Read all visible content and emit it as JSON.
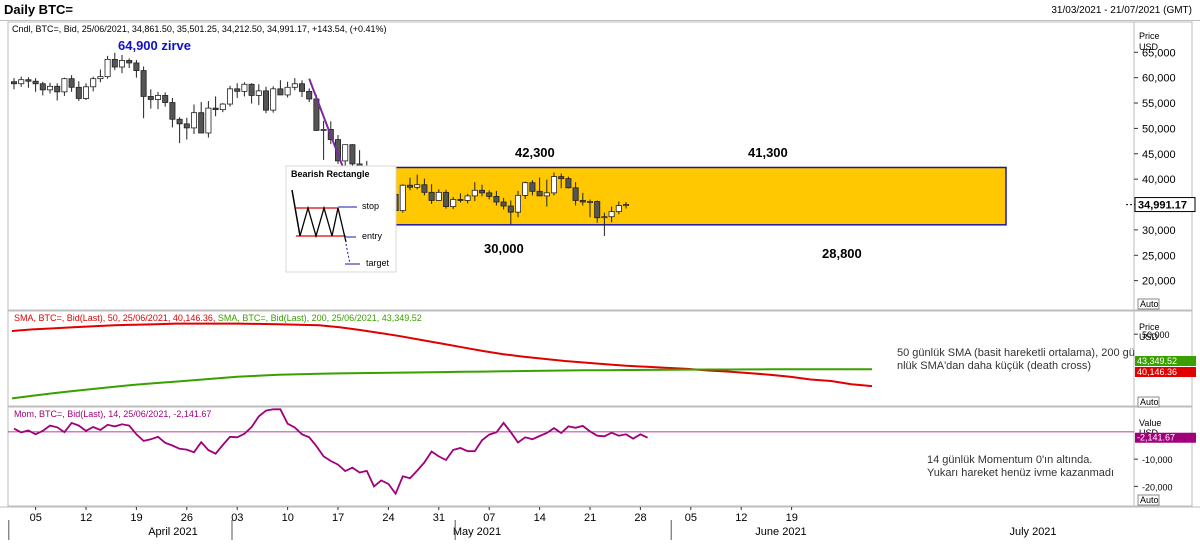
{
  "header": {
    "title": "Daily BTC=",
    "date_range": "31/03/2021 - 21/07/2021 (GMT)"
  },
  "colors": {
    "up": "#ffffff",
    "down": "#555555",
    "rect_fill": "#ffc800",
    "rect_stroke": "#1a1aa0",
    "sma50": "#e00000",
    "sma200": "#3aa000",
    "momentum": "#a0007a",
    "trend_line": "#7a2aa0",
    "annotation_blue": "#1010cc"
  },
  "chart_data": [
    {
      "type": "candlestick",
      "legend": "Cndl, BTC=, Bid, 25/06/2021, 34,861.50, 35,501.25, 34,212.50, 34,991.17, +143.54, (+0.41%)",
      "axis": {
        "title": "Price",
        "unit": "USD",
        "ylim": [
          15000,
          69000
        ],
        "ticks": [
          "65,000",
          "60,000",
          "55,000",
          "50,000",
          "45,000",
          "40,000",
          "35,000",
          "30,000",
          "25,000",
          "20,000"
        ],
        "tick_values": [
          65000,
          60000,
          55000,
          50000,
          45000,
          40000,
          35000,
          30000,
          25000,
          20000
        ]
      },
      "last_price_label": "34,991.17",
      "auto_label": "Auto",
      "annotations": [
        {
          "text": "64,900 zirve",
          "color": "blue"
        },
        {
          "text": "42,300"
        },
        {
          "text": "41,300"
        },
        {
          "text": "30,000"
        },
        {
          "text": "28,800"
        }
      ],
      "rectangle": {
        "top": 42300,
        "bottom": 31000,
        "start_index": 49,
        "end_index": 84
      },
      "trend_line": {
        "from": [
          41,
          59800
        ],
        "to": [
          49,
          30000
        ]
      },
      "inset": {
        "title": "Bearish Rectangle",
        "labels": [
          "stop",
          "entry",
          "target"
        ]
      },
      "candles": [
        [
          59200,
          59900,
          57700,
          58800
        ],
        [
          58800,
          60200,
          58200,
          59600
        ],
        [
          59600,
          60100,
          58000,
          59300
        ],
        [
          59300,
          59900,
          57200,
          58800
        ],
        [
          58800,
          59200,
          56500,
          57600
        ],
        [
          57600,
          59000,
          56900,
          58300
        ],
        [
          58300,
          58900,
          55500,
          57200
        ],
        [
          57200,
          60000,
          56400,
          59800
        ],
        [
          59800,
          60500,
          57200,
          58100
        ],
        [
          58100,
          59300,
          55400,
          55900
        ],
        [
          55900,
          58900,
          55600,
          58200
        ],
        [
          58200,
          60200,
          57300,
          59800
        ],
        [
          59800,
          61600,
          59100,
          60200
        ],
        [
          60200,
          64300,
          59800,
          63600
        ],
        [
          63600,
          64900,
          61500,
          62100
        ],
        [
          62100,
          64500,
          60900,
          63400
        ],
        [
          63400,
          63800,
          61900,
          62900
        ],
        [
          62900,
          63500,
          60000,
          61400
        ],
        [
          61400,
          62200,
          52000,
          56300
        ],
        [
          56300,
          57700,
          53900,
          55700
        ],
        [
          55700,
          57200,
          53800,
          56500
        ],
        [
          56500,
          57100,
          54300,
          55100
        ],
        [
          55100,
          56000,
          50200,
          51800
        ],
        [
          51800,
          52200,
          47100,
          50900
        ],
        [
          50900,
          52100,
          47800,
          50100
        ],
        [
          50100,
          54700,
          48900,
          53100
        ],
        [
          53100,
          55200,
          49700,
          49100
        ],
        [
          49100,
          55400,
          48200,
          54000
        ],
        [
          54000,
          56300,
          52400,
          53700
        ],
        [
          53700,
          55000,
          53200,
          54800
        ],
        [
          54800,
          58400,
          54300,
          57800
        ],
        [
          57800,
          58900,
          56000,
          57300
        ],
        [
          57300,
          59100,
          56300,
          58700
        ],
        [
          58700,
          58900,
          54900,
          56500
        ],
        [
          56500,
          58700,
          54600,
          57400
        ],
        [
          57400,
          58200,
          53000,
          53600
        ],
        [
          53600,
          58300,
          53100,
          57800
        ],
        [
          57800,
          59500,
          56900,
          56600
        ],
        [
          56600,
          59200,
          56100,
          58100
        ],
        [
          58100,
          59900,
          57500,
          58800
        ],
        [
          58800,
          59500,
          56200,
          57300
        ],
        [
          57300,
          57900,
          55200,
          55800
        ],
        [
          55800,
          56600,
          49500,
          49600
        ],
        [
          49600,
          51500,
          43800,
          49800
        ],
        [
          49800,
          51400,
          46900,
          47800
        ],
        [
          47800,
          48700,
          43000,
          43600
        ],
        [
          43600,
          45900,
          42100,
          46800
        ],
        [
          46800,
          46900,
          42600,
          43000
        ],
        [
          43000,
          45700,
          42300,
          42400
        ],
        [
          42400,
          43600,
          30000,
          37300
        ],
        [
          37300,
          42300,
          35000,
          40200
        ],
        [
          40200,
          40700,
          36400,
          38300
        ],
        [
          38300,
          39700,
          34400,
          37000
        ],
        [
          37000,
          39800,
          31300,
          33800
        ],
        [
          33800,
          39000,
          33400,
          38800
        ],
        [
          38800,
          40300,
          37800,
          38400
        ],
        [
          38400,
          40900,
          38000,
          38900
        ],
        [
          38900,
          40100,
          36800,
          37400
        ],
        [
          37400,
          39000,
          35100,
          35800
        ],
        [
          35800,
          38000,
          35700,
          37400
        ],
        [
          37400,
          37900,
          34200,
          34600
        ],
        [
          34600,
          36500,
          34100,
          36000
        ],
        [
          36000,
          37200,
          35400,
          35800
        ],
        [
          35800,
          37100,
          35200,
          36700
        ],
        [
          36700,
          39400,
          35700,
          37800
        ],
        [
          37800,
          38900,
          36600,
          37300
        ],
        [
          37300,
          37800,
          36000,
          36600
        ],
        [
          36600,
          37700,
          34800,
          35500
        ],
        [
          35500,
          36300,
          34000,
          34700
        ],
        [
          34700,
          35800,
          31100,
          33500
        ],
        [
          33500,
          37700,
          32500,
          36800
        ],
        [
          36800,
          39500,
          36100,
          39300
        ],
        [
          39300,
          39800,
          36800,
          37600
        ],
        [
          37600,
          40300,
          36800,
          36700
        ],
        [
          36700,
          39900,
          34600,
          37300
        ],
        [
          37300,
          41300,
          36800,
          40500
        ],
        [
          40500,
          41100,
          38200,
          40100
        ],
        [
          40100,
          40500,
          38200,
          38300
        ],
        [
          38300,
          39400,
          34800,
          35800
        ],
        [
          35800,
          37300,
          34800,
          35500
        ],
        [
          35500,
          36000,
          32500,
          35600
        ],
        [
          35600,
          35800,
          31400,
          32400
        ],
        [
          32400,
          33400,
          28800,
          32600
        ],
        [
          32600,
          34600,
          31500,
          33600
        ],
        [
          33600,
          35600,
          33100,
          34800
        ],
        [
          34861.5,
          35501.25,
          34212.5,
          34991.17
        ]
      ]
    },
    {
      "type": "line",
      "legend_sma50": "SMA, BTC=, Bid(Last), 50, 25/06/2021, 40,146.36,",
      "legend_sma200": "SMA, BTC=, Bid(Last), 200, 25/06/2021, 43,349.52",
      "axis": {
        "title": "Price",
        "unit": "USD",
        "ylim": [
          37500,
          52500
        ],
        "ticks": [
          "50,000"
        ],
        "tick_values": [
          50000
        ]
      },
      "value_labels": {
        "sma200": "43,349.52",
        "sma50": "40,146.36"
      },
      "auto_label": "Auto",
      "note": "50 günlük SMA (basit hareketli ortalama), 200 günlük SMA'dan daha küçük (death cross)",
      "series": [
        {
          "name": "SMA 50",
          "values": [
            50600,
            50900,
            51100,
            51300,
            51500,
            51700,
            51800,
            51900,
            52000,
            52000,
            52000,
            52000,
            51950,
            51900,
            51800,
            51700,
            51300,
            50800,
            50200,
            49600,
            48900,
            48200,
            47500,
            46800,
            46200,
            45700,
            45300,
            44900,
            44600,
            44300,
            44000,
            43800,
            43600,
            43400,
            43100,
            42900,
            42600,
            42300,
            41900,
            41400,
            41100,
            40500,
            40146.36
          ]
        },
        {
          "name": "SMA 200",
          "values": [
            37800,
            38300,
            38800,
            39200,
            39600,
            40000,
            40400,
            40700,
            41000,
            41300,
            41600,
            41900,
            42100,
            42300,
            42400,
            42500,
            42550,
            42600,
            42650,
            42700,
            42750,
            42800,
            42850,
            42900,
            42950,
            43000,
            43050,
            43100,
            43130,
            43160,
            43190,
            43220,
            43250,
            43270,
            43290,
            43300,
            43310,
            43320,
            43330,
            43335,
            43340,
            43345,
            43349.52
          ]
        }
      ]
    },
    {
      "type": "line",
      "legend": "Mom, BTC=, Bid(Last), 14, 25/06/2021, -2,141.67",
      "axis": {
        "title": "Value",
        "unit": "USD",
        "ylim": [
          -25000,
          4000
        ],
        "ticks": [
          "-10,000",
          "-20,000"
        ],
        "tick_values": [
          -10000,
          -20000
        ]
      },
      "value_label": "-2,141.67",
      "auto_label": "Auto",
      "note": "14 günlük Momentum 0'ın altında. Yukarı hareket henüz ivme kazanmadı",
      "series": [
        {
          "name": "Mom",
          "values": [
            1200,
            -200,
            500,
            -900,
            400,
            2300,
            1700,
            -100,
            3300,
            2300,
            400,
            1800,
            700,
            2600,
            2000,
            2800,
            2300,
            -900,
            -3300,
            -2700,
            -1800,
            -4000,
            -5000,
            -6200,
            -6500,
            -7500,
            -3800,
            -6700,
            -8000,
            -4800,
            -1800,
            -2000,
            -700,
            1800,
            5700,
            7800,
            8300,
            8300,
            3000,
            1600,
            -900,
            -2000,
            -5200,
            -9000,
            -10700,
            -12000,
            -14400,
            -13100,
            -14900,
            -14300,
            -20000,
            -17800,
            -19100,
            -22700,
            -16300,
            -17000,
            -14200,
            -11200,
            -7200,
            -9000,
            -10300,
            -6600,
            -5900,
            -7100,
            -7100,
            -3100,
            -1000,
            -200,
            3300,
            -100,
            -3900,
            -2000,
            -2700,
            -1500,
            -400,
            1400,
            -400,
            2000,
            1500,
            2200,
            200,
            -1400,
            -1600,
            -300,
            -1400,
            -900,
            -2500,
            -900,
            -2141.67
          ]
        }
      ]
    }
  ],
  "x_axis": {
    "day_labels": [
      "05",
      "12",
      "19",
      "26",
      "03",
      "10",
      "17",
      "24",
      "31",
      "07",
      "14",
      "21",
      "28",
      "05",
      "12",
      "19"
    ],
    "month_labels": [
      "April 2021",
      "May 2021",
      "June 2021",
      "July 2021"
    ]
  }
}
